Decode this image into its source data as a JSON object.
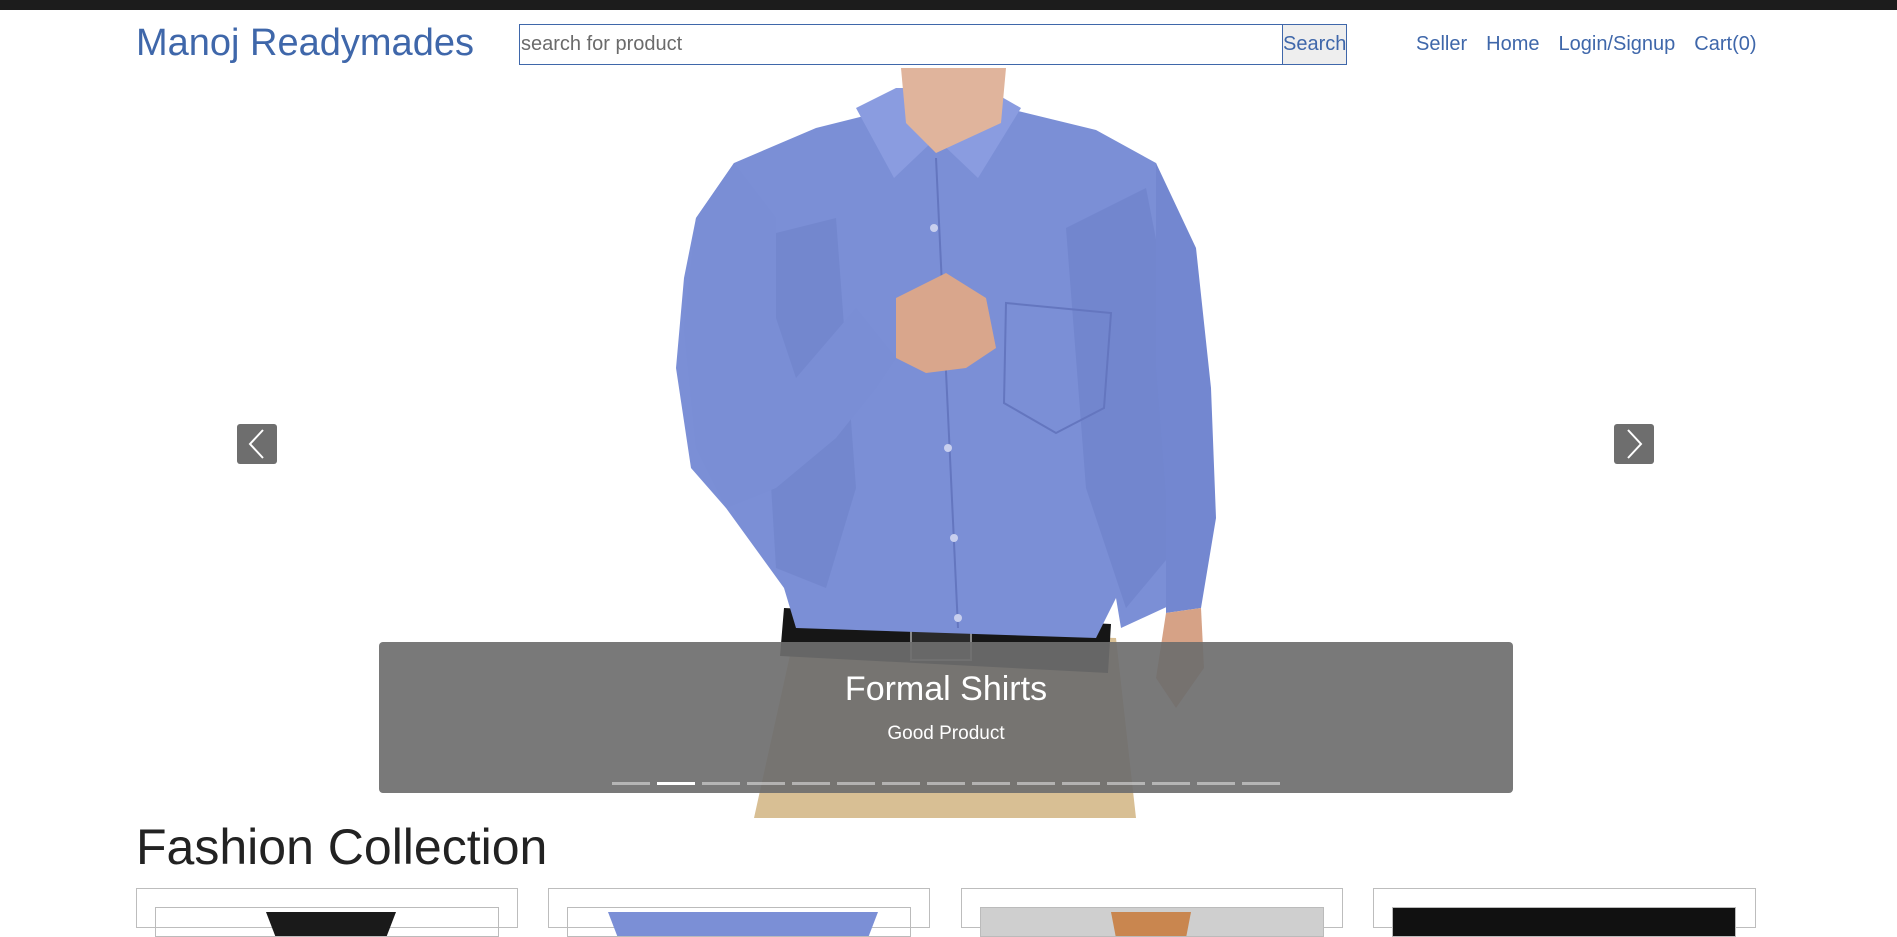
{
  "header": {
    "brand": "Manoj Readymades",
    "search": {
      "placeholder": "search for product",
      "value": "",
      "button_label": "Search"
    },
    "nav": [
      {
        "label": "Seller"
      },
      {
        "label": "Home"
      },
      {
        "label": "Login/Signup"
      },
      {
        "label": "Cart(0)"
      }
    ]
  },
  "carousel": {
    "caption_title": "Formal Shirts",
    "caption_text": "Good Product",
    "slide_count": 15,
    "active_index": 1,
    "prev_icon": "chevron-left-icon",
    "next_icon": "chevron-right-icon"
  },
  "section": {
    "title": "Fashion Collection"
  },
  "colors": {
    "brand": "#3f67aa",
    "shirt": "#7b8fd6",
    "caption_bg": "#6e6e6e"
  }
}
